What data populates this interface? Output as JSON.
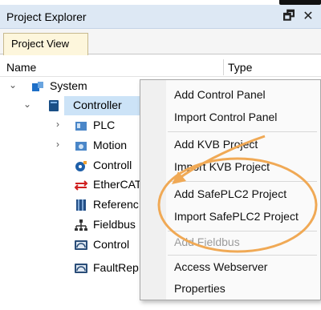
{
  "titlebar": {
    "title": "Project Explorer",
    "pin_icon": "pin-icon",
    "close_icon": "close-icon"
  },
  "tabs": [
    {
      "label": "Project View",
      "active": true
    }
  ],
  "columns": {
    "name": "Name",
    "type": "Type"
  },
  "tree": {
    "system": {
      "label": "System",
      "icon": "system-icon",
      "expanded": true
    },
    "controller": {
      "label": "Controller",
      "icon": "controller-icon",
      "expanded": true,
      "selected": true
    },
    "children": [
      {
        "label": "PLC",
        "icon": "plc-icon",
        "expandable": true
      },
      {
        "label": "Motion",
        "icon": "motion-icon",
        "expandable": true
      },
      {
        "label": "Controll",
        "icon": "controller-settings-icon",
        "expandable": false
      },
      {
        "label": "EtherCAT",
        "icon": "ethercat-icon",
        "expandable": false
      },
      {
        "label": "Referenc",
        "icon": "references-icon",
        "expandable": false
      },
      {
        "label": "Fieldbus",
        "icon": "fieldbus-icon",
        "expandable": false
      },
      {
        "label": "Control",
        "icon": "control-panel-icon",
        "expandable": false
      },
      {
        "label": "FaultRep",
        "icon": "fault-report-icon",
        "expandable": false
      }
    ]
  },
  "context_menu": {
    "items": [
      {
        "label": "Add Control Panel",
        "enabled": true
      },
      {
        "label": "Import Control Panel",
        "enabled": true
      },
      {
        "label": "Add KVB Project",
        "enabled": true
      },
      {
        "label": "Import KVB Project",
        "enabled": true
      },
      {
        "label": "Add SafePLC2 Project",
        "enabled": true
      },
      {
        "label": "Import SafePLC2 Project",
        "enabled": true
      },
      {
        "label": "Add Fieldbus",
        "enabled": false
      },
      {
        "label": "Access Webserver",
        "enabled": true
      },
      {
        "label": "Properties",
        "enabled": true
      }
    ]
  },
  "annotation": {
    "color": "#f0a955",
    "shape": "ellipse-with-arrow"
  },
  "colors": {
    "titlebar_bg": "#dde8f4",
    "tab_active_bg": "#fdf6dc",
    "selection_bg": "#cce3f7",
    "accent_blue": "#1e6fc7"
  }
}
